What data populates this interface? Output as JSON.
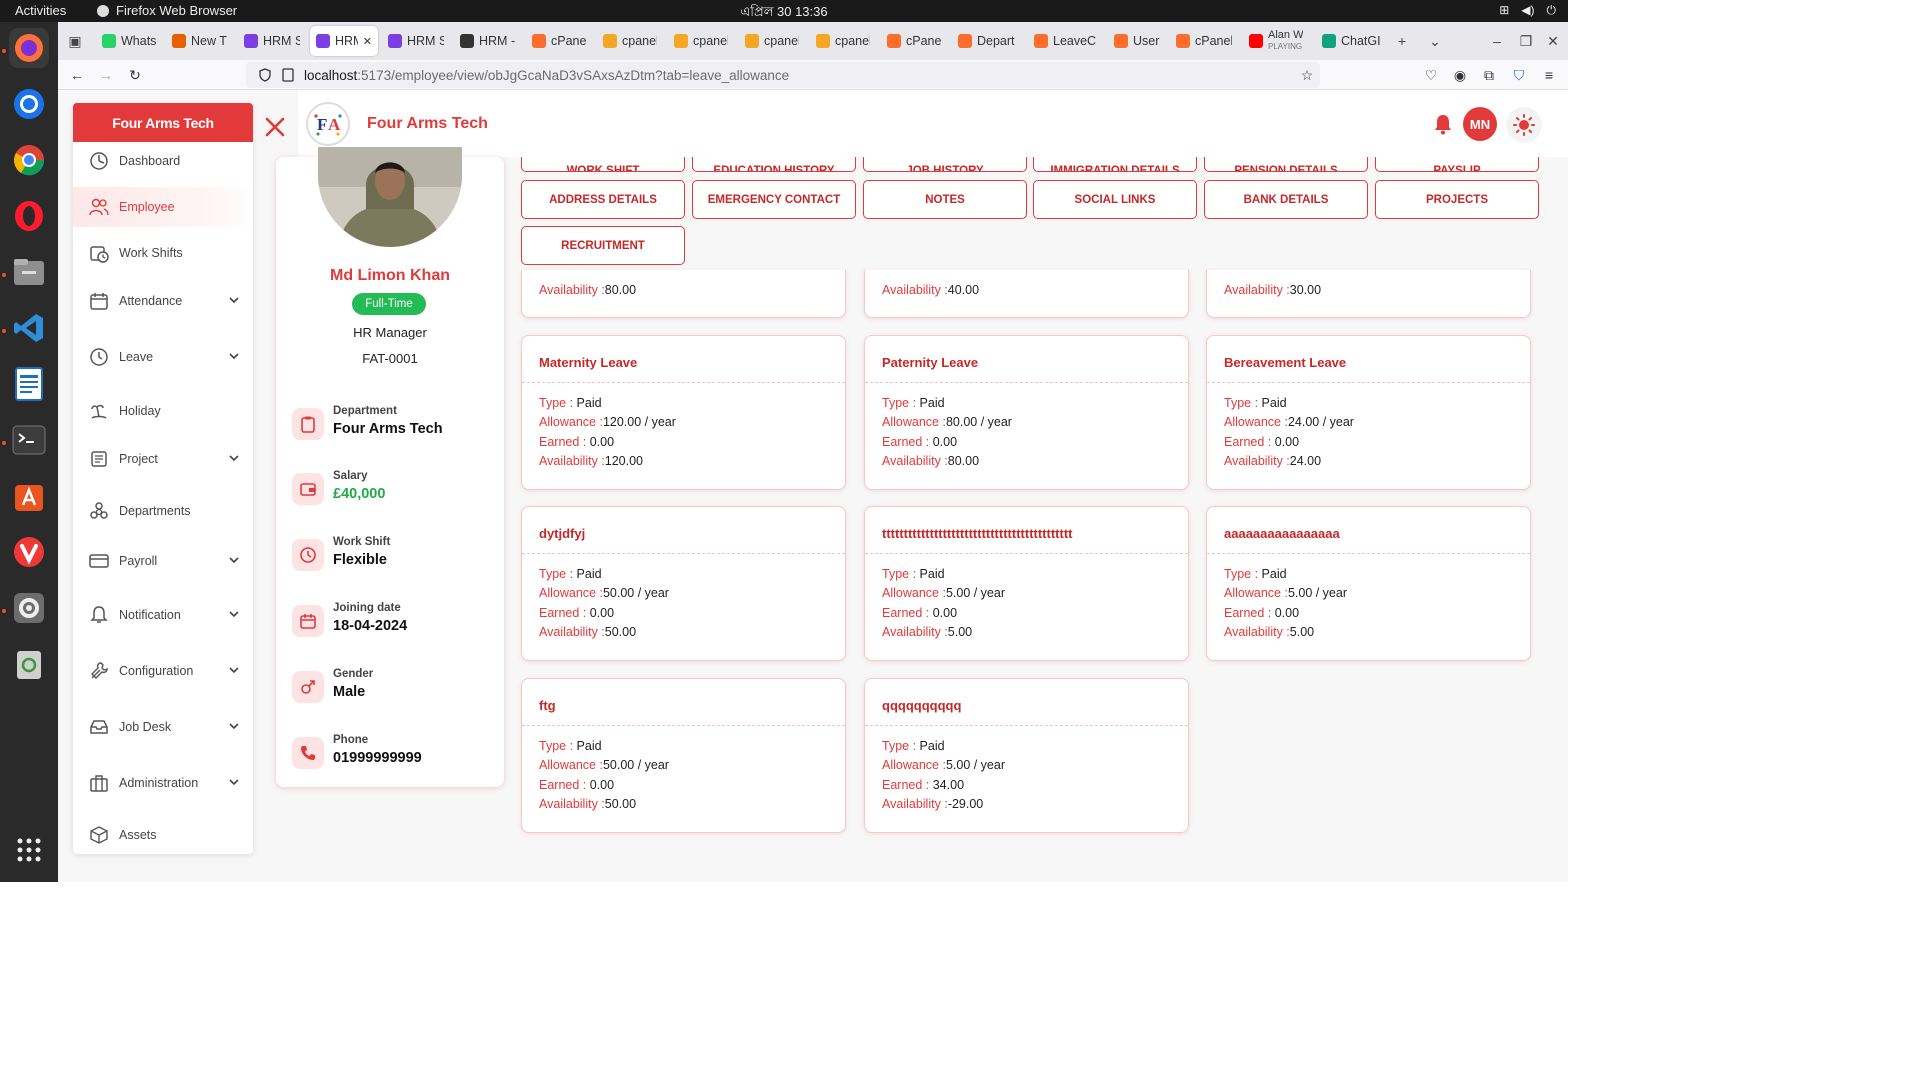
{
  "os": {
    "activities": "Activities",
    "app_name": "Firefox Web Browser",
    "clock": "এপ্রিল 30  13:36"
  },
  "browser": {
    "tabs": [
      {
        "title": "Whats",
        "color": "#25d366"
      },
      {
        "title": "New T",
        "color": "#e66000"
      },
      {
        "title": "HRM S",
        "color": "#7b3fe4"
      },
      {
        "title": "HRM",
        "color": "#7b3fe4"
      },
      {
        "title": "HRM S",
        "color": "#7b3fe4"
      },
      {
        "title": "HRM -",
        "color": "#333333"
      },
      {
        "title": "cPanel",
        "color": "#ff6c2c"
      },
      {
        "title": "cpanel",
        "color": "#f5a623"
      },
      {
        "title": "cpanel",
        "color": "#f5a623"
      },
      {
        "title": "cpanel",
        "color": "#f5a623"
      },
      {
        "title": "cpanel",
        "color": "#f5a623"
      },
      {
        "title": "cPanel",
        "color": "#ff6c2c"
      },
      {
        "title": "Depart",
        "color": "#ff6c2c"
      },
      {
        "title": "LeaveC",
        "color": "#ff6c2c"
      },
      {
        "title": "UserM",
        "color": "#ff6c2c"
      },
      {
        "title": "cPanel",
        "color": "#ff6c2c"
      },
      {
        "title": "Alan W",
        "color": "#ff0000"
      },
      {
        "title": "ChatGI",
        "color": "#10a37f"
      }
    ],
    "playing_label": "PLAYING",
    "url_host": "localhost",
    "url_rest": ":5173/employee/view/obJgGcaNaD3vSAxsAzDtm?tab=leave_allowance"
  },
  "app": {
    "brand": "Four Arms Tech",
    "company": "Four Arms Tech",
    "avatar_initials": "MN",
    "accent": "#e23a3a"
  },
  "sidebar": {
    "items": [
      {
        "label": "Dashboard"
      },
      {
        "label": "Employee"
      },
      {
        "label": "Work Shifts"
      },
      {
        "label": "Attendance"
      },
      {
        "label": "Leave"
      },
      {
        "label": "Holiday"
      },
      {
        "label": "Project"
      },
      {
        "label": "Departments"
      },
      {
        "label": "Payroll"
      },
      {
        "label": "Notification"
      },
      {
        "label": "Configuration"
      },
      {
        "label": "Job Desk"
      },
      {
        "label": "Administration"
      },
      {
        "label": "Assets"
      }
    ]
  },
  "profile": {
    "name": "Md Limon Khan",
    "employment_type": "Full-Time",
    "role": "HR Manager",
    "employee_id": "FAT-0001",
    "info": [
      {
        "label": "Department",
        "value": "Four Arms Tech"
      },
      {
        "label": "Salary",
        "value": "£40,000"
      },
      {
        "label": "Work Shift",
        "value": "Flexible"
      },
      {
        "label": "Joining date",
        "value": "18-04-2024"
      },
      {
        "label": "Gender",
        "value": "Male"
      },
      {
        "label": "Phone",
        "value": "01999999999"
      }
    ]
  },
  "tab_buttons": {
    "cut_row": [
      "WORK SHIFT",
      "EDUCATION HISTORY",
      "JOB HISTORY",
      "IMMIGRATION DETAILS",
      "PENSION DETAILS",
      "PAYSLIP"
    ],
    "row": [
      "ADDRESS DETAILS",
      "EMERGENCY CONTACT",
      "NOTES",
      "SOCIAL LINKS",
      "BANK DETAILS",
      "PROJECTS"
    ],
    "row2": [
      "RECRUITMENT"
    ]
  },
  "labels": {
    "type": "Type : ",
    "allowance": "Allowance :",
    "earned": "Earned : ",
    "availability": "Availability :"
  },
  "partial_cards": [
    {
      "availability": "80.00"
    },
    {
      "availability": "40.00"
    },
    {
      "availability": "30.00"
    }
  ],
  "leave_cards": [
    {
      "title": "Maternity Leave",
      "type": "Paid",
      "allowance": "120.00 / year",
      "earned": "0.00",
      "availability": "120.00"
    },
    {
      "title": "Paternity Leave",
      "type": "Paid",
      "allowance": "80.00 / year",
      "earned": "0.00",
      "availability": "80.00"
    },
    {
      "title": "Bereavement Leave",
      "type": "Paid",
      "allowance": "24.00 / year",
      "earned": "0.00",
      "availability": "24.00"
    },
    {
      "title": "dytjdfyj",
      "type": "Paid",
      "allowance": "50.00 / year",
      "earned": "0.00",
      "availability": "50.00"
    },
    {
      "title": "tttttttttttttttttttttttttttttttttttttttttttt",
      "type": "Paid",
      "allowance": "5.00 / year",
      "earned": "0.00",
      "availability": "5.00"
    },
    {
      "title": "aaaaaaaaaaaaaaaa",
      "type": "Paid",
      "allowance": "5.00 / year",
      "earned": "0.00",
      "availability": "5.00"
    },
    {
      "title": "ftg",
      "type": "Paid",
      "allowance": "50.00 / year",
      "earned": "0.00",
      "availability": "50.00"
    },
    {
      "title": "qqqqqqqqqq",
      "type": "Paid",
      "allowance": "5.00 / year",
      "earned": "34.00",
      "availability": "-29.00"
    }
  ]
}
